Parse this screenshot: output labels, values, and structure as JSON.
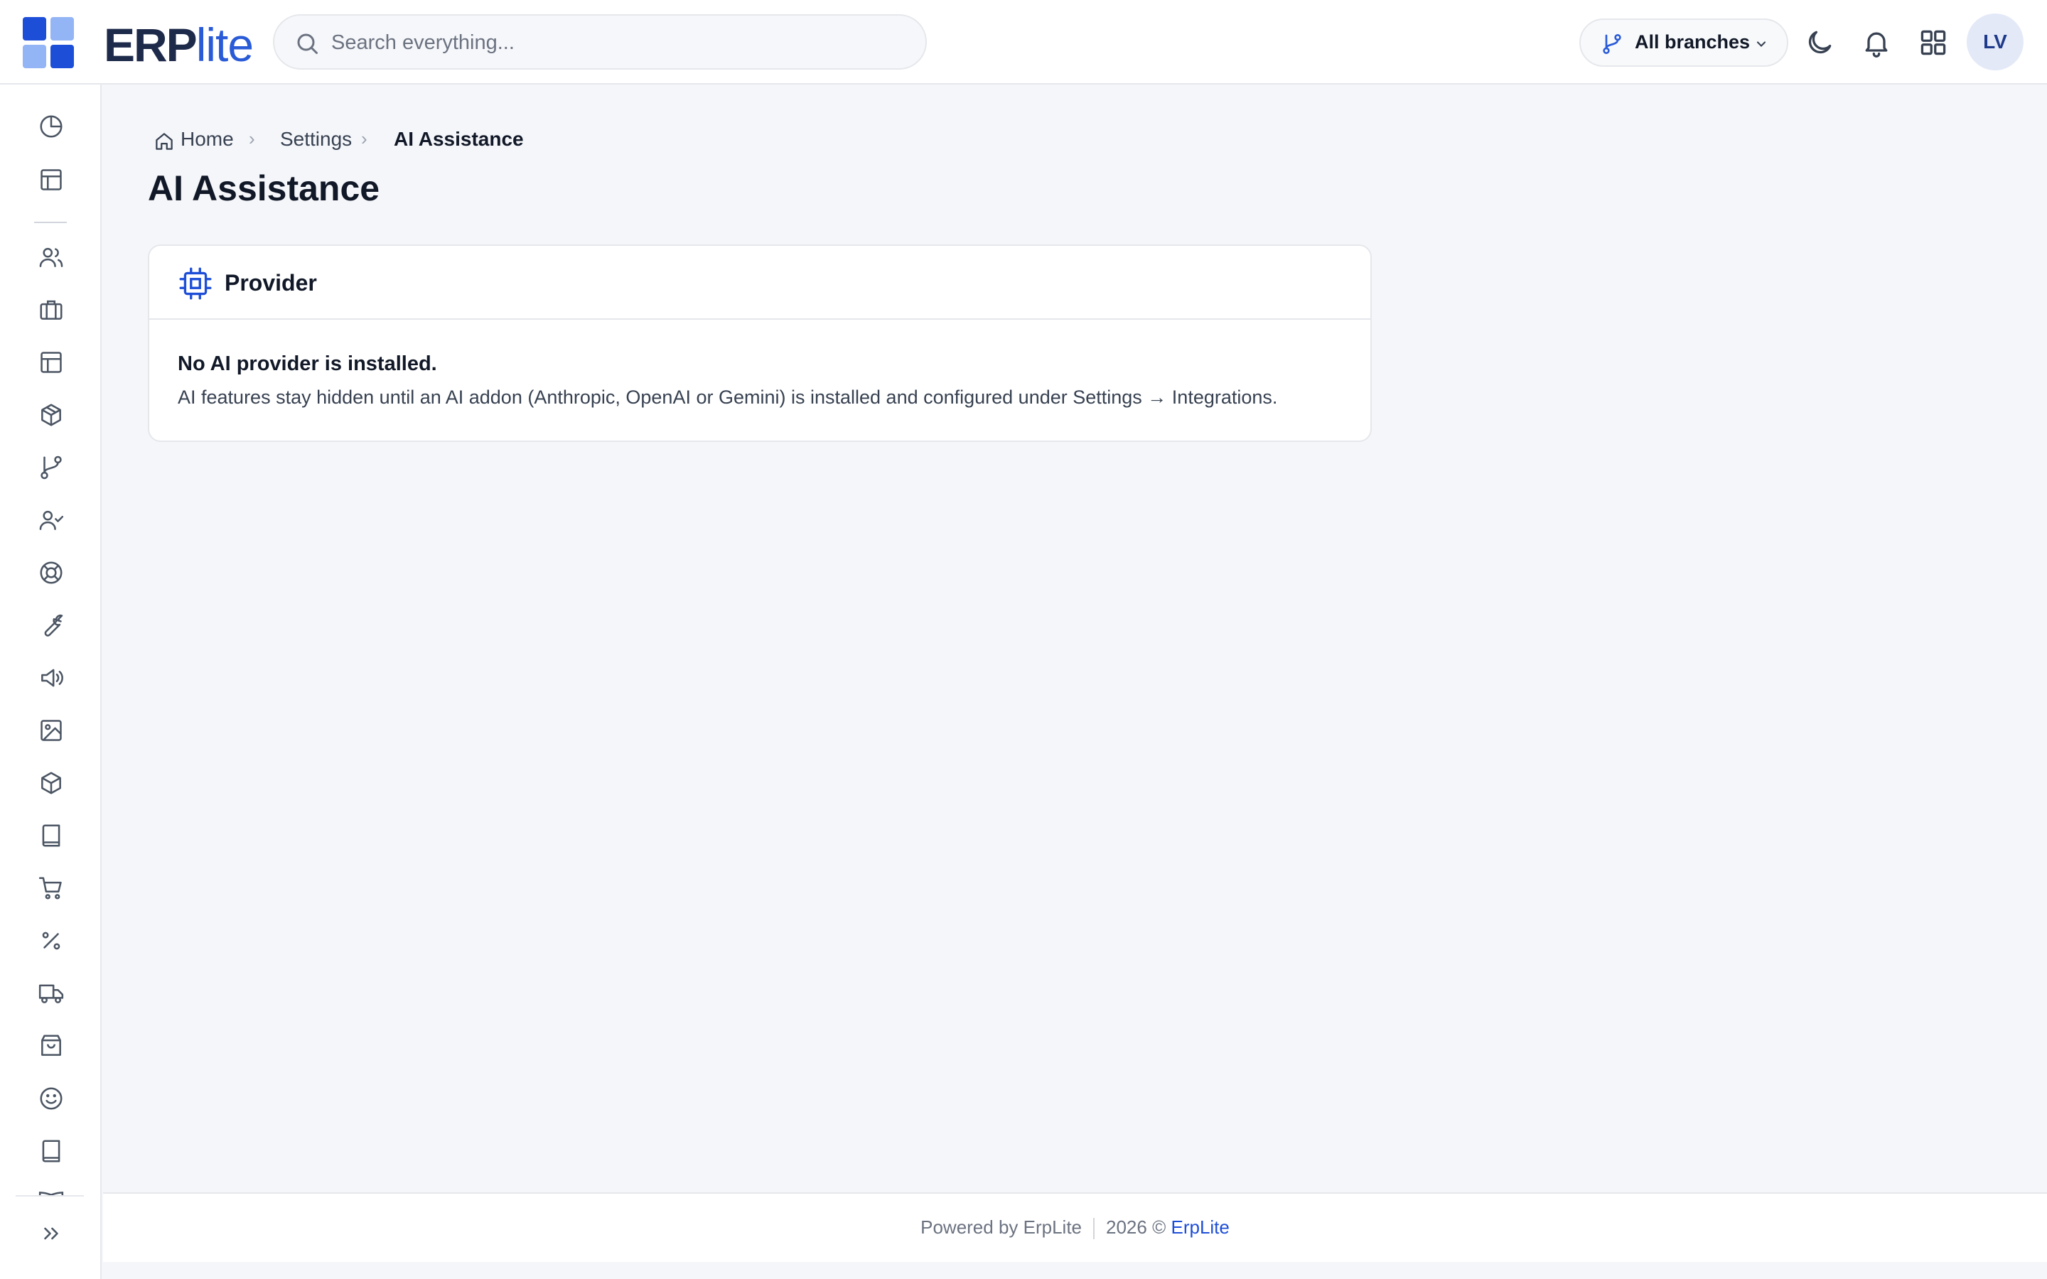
{
  "brand": {
    "name_main": "ERP",
    "name_suffix": "lite",
    "accent": "#2a5bd7"
  },
  "search": {
    "placeholder": "Search everything..."
  },
  "header": {
    "branch_label": "All branches",
    "avatar_initials": "LV",
    "icons": [
      "git-branch-icon",
      "moon-icon",
      "bell-icon",
      "grid-icon"
    ]
  },
  "sidebar": {
    "icons": [
      "pie-chart-icon",
      "layout-icon",
      "users-icon",
      "briefcase-icon",
      "layout-icon",
      "package-icon",
      "git-branch-icon",
      "user-check-icon",
      "life-buoy-icon",
      "wrench-icon",
      "megaphone-icon",
      "image-icon",
      "box-icon",
      "book-icon",
      "shopping-cart-icon",
      "percent-icon",
      "truck-icon",
      "shopping-bag-icon",
      "smile-icon",
      "book-icon",
      "book-open-icon",
      "chevrons-right-icon"
    ]
  },
  "breadcrumb": {
    "home": "Home",
    "settings": "Settings",
    "current": "AI Assistance"
  },
  "page": {
    "title": "AI Assistance"
  },
  "card": {
    "title": "Provider",
    "heading": "No AI provider is installed.",
    "description": "AI features stay hidden until an AI addon (Anthropic, OpenAI or Gemini) is installed and configured under Settings → Integrations."
  },
  "footer": {
    "powered_by": "Powered by ErpLite",
    "year": "2026 ©",
    "link": "ErpLite"
  }
}
